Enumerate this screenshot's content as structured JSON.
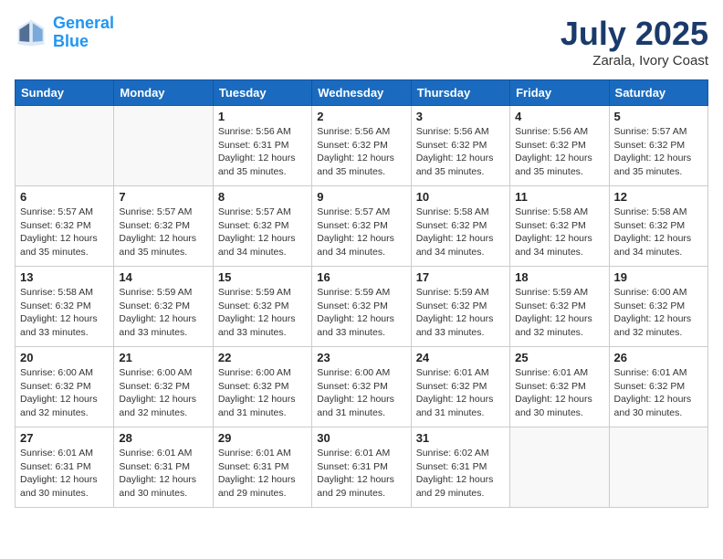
{
  "header": {
    "logo_line1": "General",
    "logo_line2": "Blue",
    "month": "July 2025",
    "location": "Zarala, Ivory Coast"
  },
  "weekdays": [
    "Sunday",
    "Monday",
    "Tuesday",
    "Wednesday",
    "Thursday",
    "Friday",
    "Saturday"
  ],
  "weeks": [
    [
      {
        "day": "",
        "info": ""
      },
      {
        "day": "",
        "info": ""
      },
      {
        "day": "1",
        "info": "Sunrise: 5:56 AM\nSunset: 6:31 PM\nDaylight: 12 hours and 35 minutes."
      },
      {
        "day": "2",
        "info": "Sunrise: 5:56 AM\nSunset: 6:32 PM\nDaylight: 12 hours and 35 minutes."
      },
      {
        "day": "3",
        "info": "Sunrise: 5:56 AM\nSunset: 6:32 PM\nDaylight: 12 hours and 35 minutes."
      },
      {
        "day": "4",
        "info": "Sunrise: 5:56 AM\nSunset: 6:32 PM\nDaylight: 12 hours and 35 minutes."
      },
      {
        "day": "5",
        "info": "Sunrise: 5:57 AM\nSunset: 6:32 PM\nDaylight: 12 hours and 35 minutes."
      }
    ],
    [
      {
        "day": "6",
        "info": "Sunrise: 5:57 AM\nSunset: 6:32 PM\nDaylight: 12 hours and 35 minutes."
      },
      {
        "day": "7",
        "info": "Sunrise: 5:57 AM\nSunset: 6:32 PM\nDaylight: 12 hours and 35 minutes."
      },
      {
        "day": "8",
        "info": "Sunrise: 5:57 AM\nSunset: 6:32 PM\nDaylight: 12 hours and 34 minutes."
      },
      {
        "day": "9",
        "info": "Sunrise: 5:57 AM\nSunset: 6:32 PM\nDaylight: 12 hours and 34 minutes."
      },
      {
        "day": "10",
        "info": "Sunrise: 5:58 AM\nSunset: 6:32 PM\nDaylight: 12 hours and 34 minutes."
      },
      {
        "day": "11",
        "info": "Sunrise: 5:58 AM\nSunset: 6:32 PM\nDaylight: 12 hours and 34 minutes."
      },
      {
        "day": "12",
        "info": "Sunrise: 5:58 AM\nSunset: 6:32 PM\nDaylight: 12 hours and 34 minutes."
      }
    ],
    [
      {
        "day": "13",
        "info": "Sunrise: 5:58 AM\nSunset: 6:32 PM\nDaylight: 12 hours and 33 minutes."
      },
      {
        "day": "14",
        "info": "Sunrise: 5:59 AM\nSunset: 6:32 PM\nDaylight: 12 hours and 33 minutes."
      },
      {
        "day": "15",
        "info": "Sunrise: 5:59 AM\nSunset: 6:32 PM\nDaylight: 12 hours and 33 minutes."
      },
      {
        "day": "16",
        "info": "Sunrise: 5:59 AM\nSunset: 6:32 PM\nDaylight: 12 hours and 33 minutes."
      },
      {
        "day": "17",
        "info": "Sunrise: 5:59 AM\nSunset: 6:32 PM\nDaylight: 12 hours and 33 minutes."
      },
      {
        "day": "18",
        "info": "Sunrise: 5:59 AM\nSunset: 6:32 PM\nDaylight: 12 hours and 32 minutes."
      },
      {
        "day": "19",
        "info": "Sunrise: 6:00 AM\nSunset: 6:32 PM\nDaylight: 12 hours and 32 minutes."
      }
    ],
    [
      {
        "day": "20",
        "info": "Sunrise: 6:00 AM\nSunset: 6:32 PM\nDaylight: 12 hours and 32 minutes."
      },
      {
        "day": "21",
        "info": "Sunrise: 6:00 AM\nSunset: 6:32 PM\nDaylight: 12 hours and 32 minutes."
      },
      {
        "day": "22",
        "info": "Sunrise: 6:00 AM\nSunset: 6:32 PM\nDaylight: 12 hours and 31 minutes."
      },
      {
        "day": "23",
        "info": "Sunrise: 6:00 AM\nSunset: 6:32 PM\nDaylight: 12 hours and 31 minutes."
      },
      {
        "day": "24",
        "info": "Sunrise: 6:01 AM\nSunset: 6:32 PM\nDaylight: 12 hours and 31 minutes."
      },
      {
        "day": "25",
        "info": "Sunrise: 6:01 AM\nSunset: 6:32 PM\nDaylight: 12 hours and 30 minutes."
      },
      {
        "day": "26",
        "info": "Sunrise: 6:01 AM\nSunset: 6:32 PM\nDaylight: 12 hours and 30 minutes."
      }
    ],
    [
      {
        "day": "27",
        "info": "Sunrise: 6:01 AM\nSunset: 6:31 PM\nDaylight: 12 hours and 30 minutes."
      },
      {
        "day": "28",
        "info": "Sunrise: 6:01 AM\nSunset: 6:31 PM\nDaylight: 12 hours and 30 minutes."
      },
      {
        "day": "29",
        "info": "Sunrise: 6:01 AM\nSunset: 6:31 PM\nDaylight: 12 hours and 29 minutes."
      },
      {
        "day": "30",
        "info": "Sunrise: 6:01 AM\nSunset: 6:31 PM\nDaylight: 12 hours and 29 minutes."
      },
      {
        "day": "31",
        "info": "Sunrise: 6:02 AM\nSunset: 6:31 PM\nDaylight: 12 hours and 29 minutes."
      },
      {
        "day": "",
        "info": ""
      },
      {
        "day": "",
        "info": ""
      }
    ]
  ]
}
